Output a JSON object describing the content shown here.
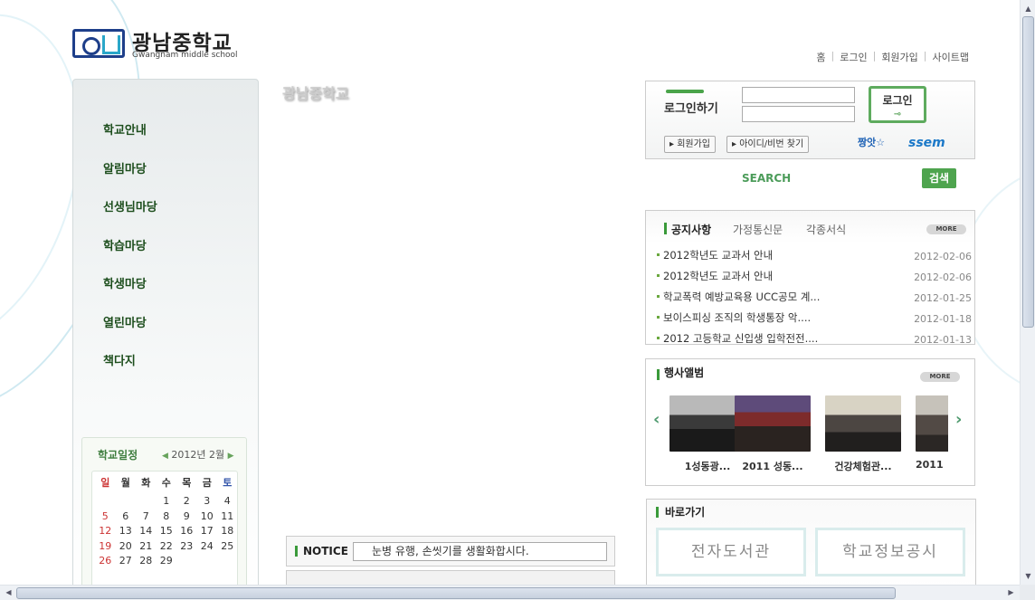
{
  "logo": {
    "title": "광남중학교",
    "subtitle": "Gwangnam middle school"
  },
  "topnav": [
    "홈",
    "로그인",
    "회원가입",
    "사이트맵"
  ],
  "left_menu": [
    "학교안내",
    "알림마당",
    "선생님마당",
    "학습마당",
    "학생마당",
    "열린마당",
    "책다지"
  ],
  "calendar": {
    "title": "학교일정",
    "month": "2012년 2월",
    "weekdays": [
      "일",
      "월",
      "화",
      "수",
      "목",
      "금",
      "토"
    ],
    "days": [
      "",
      "",
      "",
      "1",
      "2",
      "3",
      "4",
      "5",
      "6",
      "7",
      "8",
      "9",
      "10",
      "11",
      "12",
      "13",
      "14",
      "15",
      "16",
      "17",
      "18",
      "19",
      "20",
      "21",
      "22",
      "23",
      "24",
      "25",
      "26",
      "27",
      "28",
      "29",
      "",
      "",
      ""
    ]
  },
  "main_title": "광남중학교",
  "notice": {
    "label": "NOTICE",
    "ticker": "눈병 유행, 손씻기를 생활화합시다."
  },
  "login": {
    "title": "로그인하기",
    "button": "로그인",
    "join": "▸ 회원가입",
    "find": "▸ 아이디/비번 찾기",
    "badge1": "짱앗☆",
    "badge2": "ssem"
  },
  "search": {
    "label": "SEARCH",
    "button": "검색"
  },
  "news": {
    "tabs": [
      "공지사항",
      "가정통신문",
      "각종서식"
    ],
    "more": "MORE",
    "items": [
      {
        "title": "2012학년도 교과서 안내",
        "date": "2012-02-06"
      },
      {
        "title": "2012학년도 교과서 안내",
        "date": "2012-02-06"
      },
      {
        "title": "학교폭력 예방교육용 UCC공모 계...",
        "date": "2012-01-25"
      },
      {
        "title": "보이스피싱 조직의 학생통장 악....",
        "date": "2012-01-18"
      },
      {
        "title": "2012 고등학교 신입생 입학전전....",
        "date": "2012-01-13"
      }
    ]
  },
  "album": {
    "title": "행사앨범",
    "more": "MORE",
    "prev": "‹",
    "next": "›",
    "items": [
      "1성동광...",
      "2011 성동...",
      "건강체험관...",
      "2011"
    ]
  },
  "quicklinks": {
    "title": "바로가기",
    "items": [
      "전자도서관",
      "학교정보공시"
    ]
  },
  "scrollbar": {
    "up": "▲",
    "down": "▼",
    "left": "◀",
    "right": "▶"
  }
}
